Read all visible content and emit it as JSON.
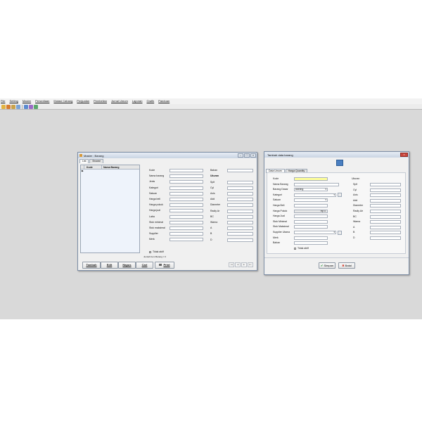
{
  "menu": [
    "File",
    "Setting",
    "Master",
    "Persediaan",
    "Mutasi Cabang",
    "Penjualan",
    "Pembelian",
    "Jurnal Umum",
    "Laporan",
    "Grafik",
    "Panduan"
  ],
  "colors": {
    "desktop": "#d9d9d9",
    "highlight": "#ffff99",
    "titlebar": "#c9d4e3",
    "save_icon": "#2e9e3e",
    "cancel_icon": "#d23a2a"
  },
  "master": {
    "title": "Master : Barang",
    "tabs": [
      "List",
      "Browse"
    ],
    "grid": {
      "col_kode": "Kode",
      "col_nama": "Nama Barang",
      "row_indicator": "▶"
    },
    "left_fields": [
      "Kode",
      "Nama barang",
      "Jenis",
      "Kategori",
      "Satuan",
      "Harga beli",
      "Harga pokok",
      "Harga jual",
      "Laba",
      "Stok minimal",
      "Stok maksimal",
      "Supplier",
      "Merk"
    ],
    "right_top_label": "Bahan",
    "right_section": "Ukuran",
    "right_fields": [
      "Spit",
      "Cyl",
      "Axis",
      "Add",
      "Diameter",
      "Radiy Ar",
      "BC",
      "Warna",
      "A",
      "B",
      "D"
    ],
    "checkbox_label": "Tidak aktif",
    "count_label": "Jumlah Item Barang = 0",
    "buttons": {
      "tambah": "Tambah",
      "edit": "Edit",
      "hapus": "Hapus",
      "cari": "Cari",
      "print": "Print"
    }
  },
  "tambah": {
    "title": "Tambah data barang",
    "tabs": [
      "Data Umum",
      "Harga Quantity"
    ],
    "left_fields": [
      "Kode",
      "Nama Barang",
      "Barang Dasar",
      "Kategori",
      "Satuan",
      "Harga Beli",
      "Harga Pokok",
      "Harga Jual",
      "Stok Minimal",
      "Stok Maksimal",
      "Supplier Utama",
      "Merk",
      "Bahan"
    ],
    "barang_dasar_value": "Barang",
    "harga_pokok_value": "Rp 0",
    "right_section": "Ukuran",
    "right_fields": [
      "Spit",
      "Cyl",
      "Axis",
      "Add",
      "Diameter",
      "Radiy Air",
      "BC",
      "Warna",
      "A",
      "B",
      "D"
    ],
    "checkbox_label": "Tidak aktif",
    "buttons": {
      "simpan": "Simpan",
      "batal": "Batal"
    }
  }
}
